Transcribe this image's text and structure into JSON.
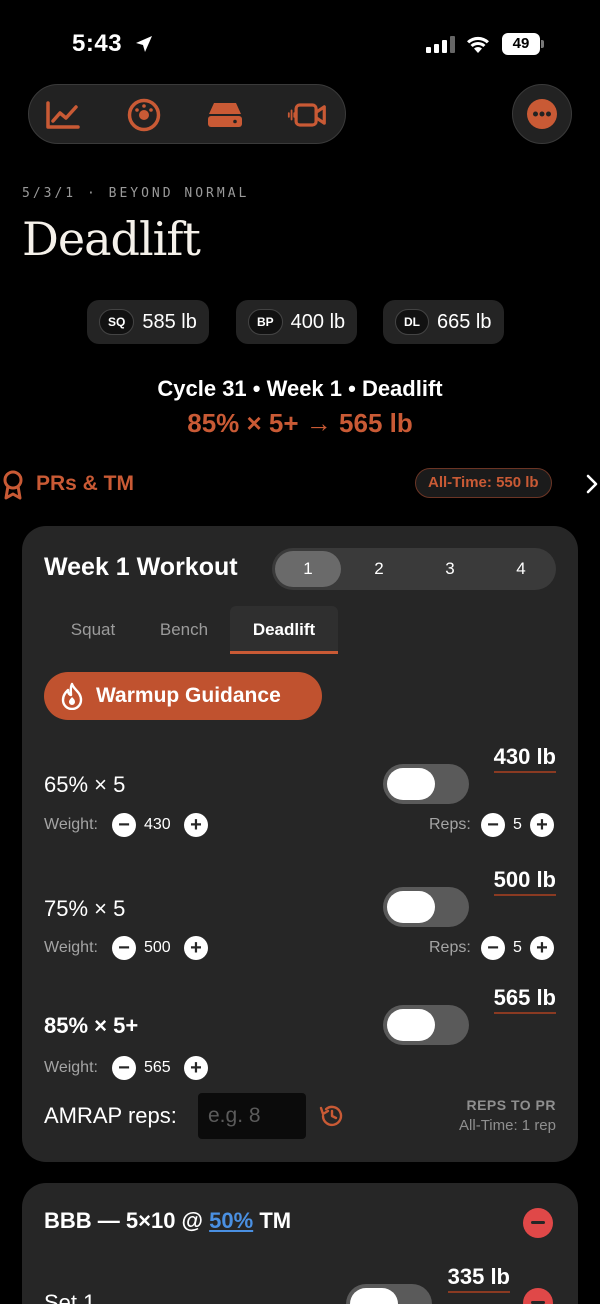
{
  "status_bar": {
    "time": "5:43",
    "battery": "49"
  },
  "program": {
    "subtitle": "5/3/1 · BEYOND NORMAL",
    "title": "Deadlift"
  },
  "lifts": [
    {
      "tag": "SQ",
      "value": "585 lb"
    },
    {
      "tag": "BP",
      "value": "400 lb"
    },
    {
      "tag": "DL",
      "value": "665 lb"
    }
  ],
  "summary": {
    "cycle_line": "Cycle 31 • Week 1 • Deadlift",
    "target_line": "85% × 5+ → 565 lb"
  },
  "prs": {
    "label": "PRs & TM",
    "all_time": "All-Time: 550 lb"
  },
  "workout": {
    "title": "Week 1 Workout",
    "weeks": [
      "1",
      "2",
      "3",
      "4"
    ],
    "selected_week": "1",
    "tabs": [
      "Squat",
      "Bench",
      "Deadlift"
    ],
    "selected_tab": "Deadlift",
    "warmup_label": "Warmup Guidance",
    "weight_label": "Weight:",
    "reps_label": "Reps:",
    "sets": [
      {
        "label": "65% × 5",
        "weight": "430 lb",
        "weight_value": "430",
        "reps_value": "5"
      },
      {
        "label": "75% × 5",
        "weight": "500 lb",
        "weight_value": "500",
        "reps_value": "5"
      },
      {
        "label": "85% × 5+",
        "weight": "565 lb",
        "weight_value": "565"
      }
    ],
    "amrap": {
      "label": "AMRAP reps:",
      "placeholder": "e.g. 8"
    },
    "reps_to_pr": {
      "heading": "REPS TO PR",
      "value": "All-Time: 1 rep"
    }
  },
  "bbb": {
    "title_prefix": "BBB — 5×10 @",
    "percent": "50%",
    "title_suffix": "TM",
    "first_set": {
      "label": "Set 1",
      "weight": "335 lb"
    }
  },
  "colors": {
    "accent": "#c95a35",
    "link": "#4a90e2",
    "danger": "#e04848"
  }
}
